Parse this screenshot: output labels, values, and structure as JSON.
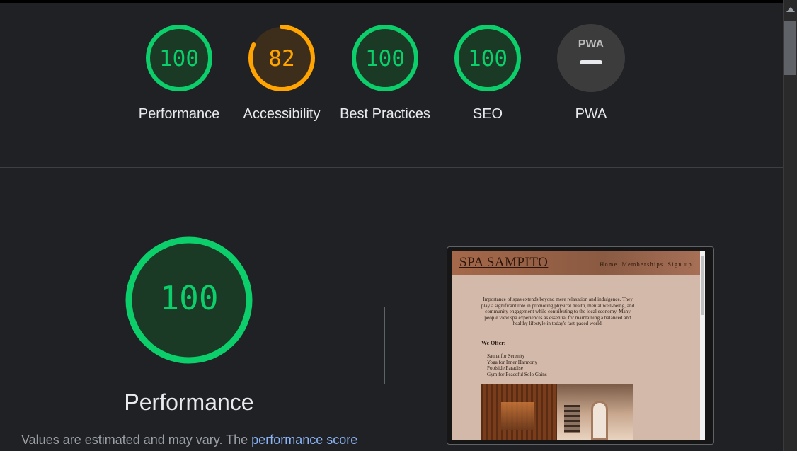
{
  "colors": {
    "pass": "#0cce6b",
    "pass_fill": "#1b3a26",
    "average": "#ffa400",
    "average_fill": "#3d2e1c",
    "na_fill": "#3c3c3c",
    "na_text": "#e8eaed"
  },
  "gauges": [
    {
      "id": "performance",
      "score": 100,
      "label": "Performance",
      "rating": "pass"
    },
    {
      "id": "accessibility",
      "score": 82,
      "label": "Accessibility",
      "rating": "average"
    },
    {
      "id": "best-practices",
      "score": 100,
      "label": "Best Practices",
      "rating": "pass"
    },
    {
      "id": "seo",
      "score": 100,
      "label": "SEO",
      "rating": "pass"
    },
    {
      "id": "pwa",
      "score": null,
      "label": "PWA",
      "rating": "na",
      "badge": "PWA"
    }
  ],
  "category": {
    "title": "Performance",
    "score": "100",
    "note_prefix": "Values are estimated and may vary. The ",
    "note_link": "performance score"
  },
  "screenshot": {
    "logo": "SPA SAMPITO",
    "nav": [
      "Home",
      "Memberships",
      "Sign up"
    ],
    "intro": "Importance of spas extends beyond mere relaxation and indulgence. They play a significant role in promoting physical health, mental well-being, and community engagement while contributing to the local economy. Many people view spa experiences as essential for maintaining a balanced and healthy lifestyle in today's fast-paced world.",
    "offer_heading": "We Offer:",
    "offers": [
      "Sauna for Serenity",
      "Yoga for Inner Harmony",
      "Poolside Paradise",
      "Gym for Peaceful Solo Gains"
    ]
  }
}
